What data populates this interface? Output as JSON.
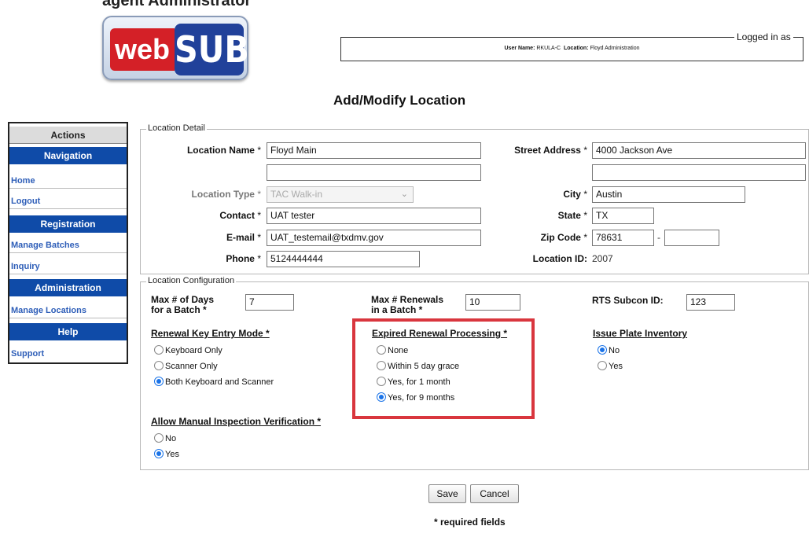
{
  "header": {
    "top_cut_text": "agent Administrator",
    "logo": {
      "part1": "web",
      "part2": "SUB"
    },
    "logged_in_legend": "Logged in as",
    "user_name_label": "User Name:",
    "user_name": "RKULA-C",
    "location_label": "Location:",
    "location": "Floyd Administration"
  },
  "page_title": "Add/Modify Location",
  "sidebar": {
    "actions_label": "Actions",
    "sections": [
      {
        "title": "Navigation",
        "links": [
          "Home",
          "Logout"
        ]
      },
      {
        "title": "Registration",
        "links": [
          "Manage Batches",
          "Inquiry"
        ]
      },
      {
        "title": "Administration",
        "links": [
          "Manage Locations"
        ]
      },
      {
        "title": "Help",
        "links": [
          "Support"
        ]
      }
    ]
  },
  "location_detail": {
    "legend": "Location Detail",
    "location_name_label": "Location Name",
    "location_name": "Floyd Main",
    "location_name_2": "",
    "location_type_label": "Location Type",
    "location_type": "TAC Walk-in",
    "contact_label": "Contact",
    "contact": "UAT tester",
    "email_label": "E-mail",
    "email": "UAT_testemail@txdmv.gov",
    "phone_label": "Phone",
    "phone": "5124444444",
    "street_address_label": "Street Address",
    "street_address": "4000 Jackson Ave",
    "street_address_2": "",
    "city_label": "City",
    "city": "Austin",
    "state_label": "State",
    "state": "TX",
    "zip_label": "Zip Code",
    "zip": "78631",
    "zip_ext": "",
    "zip_sep": "-",
    "location_id_label": "Location ID:",
    "location_id": "2007",
    "req_mark": "*"
  },
  "location_config": {
    "legend": "Location Configuration",
    "max_days_label_1": "Max # of Days",
    "max_days_label_2": "for a Batch *",
    "max_days": "7",
    "max_renewals_label_1": "Max # Renewals",
    "max_renewals_label_2": "in a Batch *",
    "max_renewals": "10",
    "rts_label": "RTS Subcon ID:",
    "rts_id": "123",
    "renewal_key_title": "Renewal Key Entry Mode *",
    "renewal_key_options": [
      "Keyboard Only",
      "Scanner Only",
      "Both Keyboard and Scanner"
    ],
    "renewal_key_selected": 2,
    "expired_title": "Expired Renewal Processing *",
    "expired_options": [
      "None",
      "Within 5 day grace",
      "Yes, for 1 month",
      "Yes, for 9 months"
    ],
    "expired_selected": 3,
    "plate_title": "Issue Plate Inventory",
    "plate_options": [
      "No",
      "Yes"
    ],
    "plate_selected": 0,
    "manual_title": "Allow Manual Inspection Verification *",
    "manual_options": [
      "No",
      "Yes"
    ],
    "manual_selected": 1
  },
  "buttons": {
    "save": "Save",
    "cancel": "Cancel"
  },
  "required_note": "* required fields",
  "colors": {
    "nav_blue": "#0f4ba8",
    "highlight_red": "#d9363e",
    "radio_blue": "#1a73e8"
  }
}
